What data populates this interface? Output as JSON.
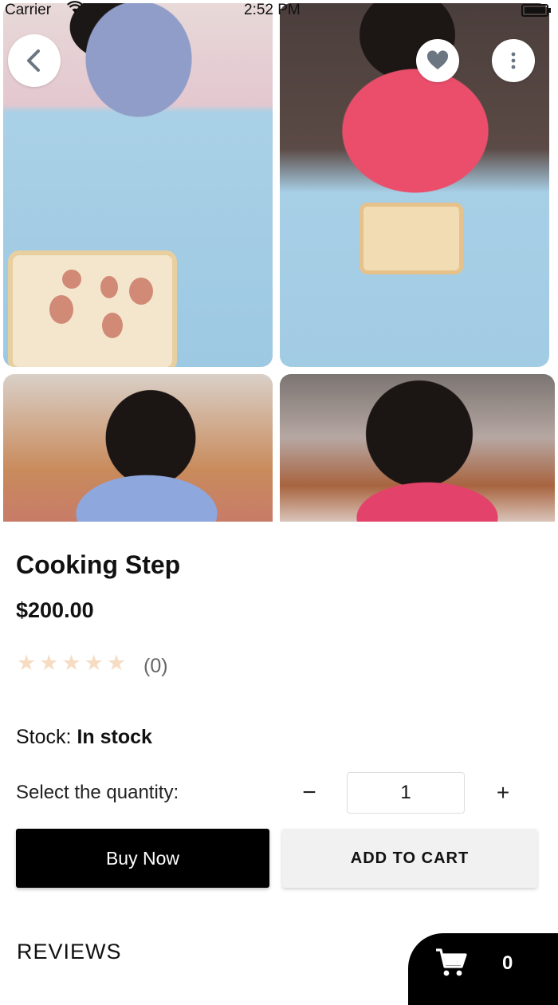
{
  "status_bar": {
    "carrier": "Carrier",
    "time": "2:52 PM"
  },
  "gallery": {
    "photos": [
      "child-cutting-sausage",
      "child-making-toast",
      "child-at-table",
      "child-looking-down"
    ]
  },
  "icons": {
    "back": "back-icon",
    "favorite": "heart-icon",
    "more": "more-icon",
    "cart": "cart-icon",
    "star": "star-icon"
  },
  "product": {
    "title": "Cooking Step",
    "price": "$200.00",
    "rating_count": "(0)",
    "stars_filled": 0,
    "stars_total": 5,
    "stock_label": "Stock:",
    "stock_value": "In stock"
  },
  "quantity": {
    "label": "Select the quantity:",
    "minus": "−",
    "value": "1",
    "plus": "+"
  },
  "actions": {
    "buy_now": "Buy Now",
    "add_to_cart": "ADD TO CART"
  },
  "reviews": {
    "heading": "REVIEWS"
  },
  "cart": {
    "count": "0"
  },
  "colors": {
    "star": "#f7dcc4",
    "primary": "#000000",
    "secondary_button": "#f1f1f1"
  }
}
